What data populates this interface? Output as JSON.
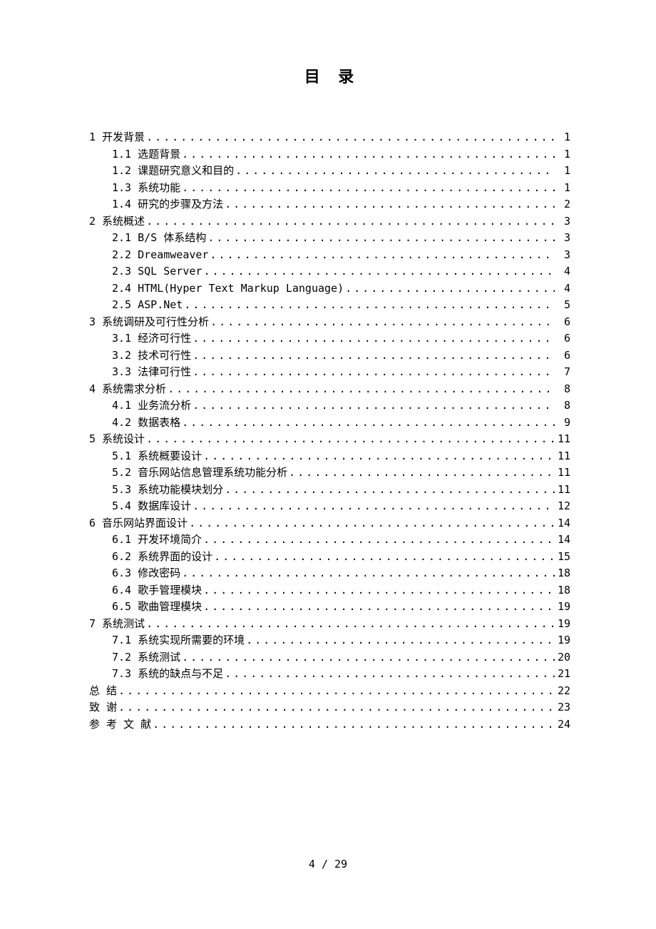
{
  "title": "目 录",
  "footer": "4 / 29",
  "toc": [
    {
      "level": 1,
      "label": "1   开发背景",
      "page": "1"
    },
    {
      "level": 2,
      "label": "1.1 选题背景",
      "page": "1"
    },
    {
      "level": 2,
      "label": "1.2 课题研究意义和目的",
      "page": "1"
    },
    {
      "level": 2,
      "label": "1.3  系统功能",
      "page": "1"
    },
    {
      "level": 2,
      "label": "1.4 研究的步骤及方法",
      "page": "2"
    },
    {
      "level": 1,
      "label": "2 系统概述",
      "page": "3"
    },
    {
      "level": 2,
      "label": "2.1 B/S 体系结构",
      "page": "3"
    },
    {
      "level": 2,
      "label": "2.2 Dreamweaver",
      "page": "3"
    },
    {
      "level": 2,
      "label": "2.3 SQL Server",
      "page": "4"
    },
    {
      "level": 2,
      "label": "2.4 HTML(Hyper Text Markup Language)",
      "page": "4"
    },
    {
      "level": 2,
      "label": "2.5 ASP.Net",
      "page": "5"
    },
    {
      "level": 1,
      "label": "3 系统调研及可行性分析",
      "page": "6"
    },
    {
      "level": 2,
      "label": "3.1 经济可行性",
      "page": "6"
    },
    {
      "level": 2,
      "label": "3.2 技术可行性",
      "page": "6"
    },
    {
      "level": 2,
      "label": "3.3 法律可行性",
      "page": "7"
    },
    {
      "level": 1,
      "label": "4   系统需求分析",
      "page": "8"
    },
    {
      "level": 2,
      "label": "4.1 业务流分析",
      "page": "8"
    },
    {
      "level": 2,
      "label": "4.2 数据表格",
      "page": "9"
    },
    {
      "level": 1,
      "label": "5   系统设计",
      "page": "11"
    },
    {
      "level": 2,
      "label": "5.1 系统概要设计",
      "page": "11"
    },
    {
      "level": 2,
      "label": "5.2 音乐网站信息管理系统功能分析",
      "page": "11"
    },
    {
      "level": 2,
      "label": "5.3   系统功能模块划分",
      "page": "11"
    },
    {
      "level": 2,
      "label": "5.4 数据库设计",
      "page": "12"
    },
    {
      "level": 1,
      "label": "6 音乐网站界面设计",
      "page": "14"
    },
    {
      "level": 2,
      "label": "6.1 开发环境简介",
      "page": "14"
    },
    {
      "level": 2,
      "label": "6.2 系统界面的设计",
      "page": "15"
    },
    {
      "level": 2,
      "label": "6.3 修改密码",
      "page": "18"
    },
    {
      "level": 2,
      "label": "6.4 歌手管理模块",
      "page": "18"
    },
    {
      "level": 2,
      "label": "6.5 歌曲管理模块",
      "page": "19"
    },
    {
      "level": 1,
      "label": "7 系统测试",
      "page": "19"
    },
    {
      "level": 2,
      "label": "7.1 系统实现所需要的环境",
      "page": "19"
    },
    {
      "level": 2,
      "label": "7.2 系统测试",
      "page": "20"
    },
    {
      "level": 2,
      "label": "7.3 系统的缺点与不足",
      "page": "21"
    },
    {
      "level": 1,
      "label": "总   结",
      "page": "22"
    },
    {
      "level": 1,
      "label": "致   谢",
      "page": "23"
    },
    {
      "level": 1,
      "label": "参   考   文   献",
      "page": "24"
    }
  ]
}
